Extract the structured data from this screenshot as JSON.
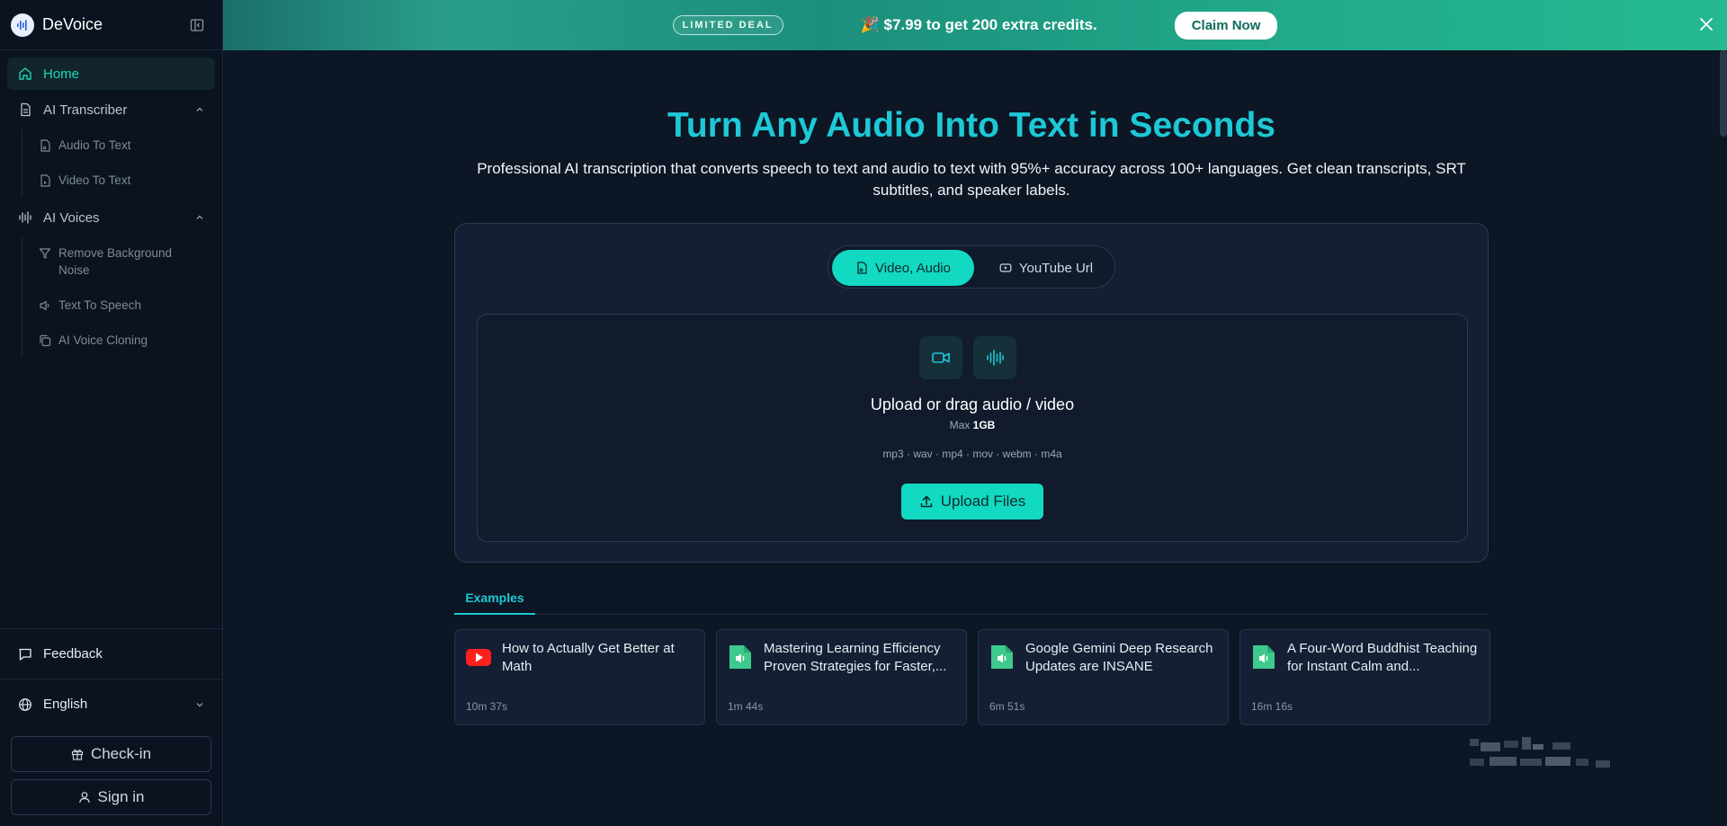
{
  "app": {
    "name": "DeVoice"
  },
  "sidebar": {
    "home": "Home",
    "transcriber": {
      "label": "AI Transcriber",
      "items": [
        "Audio To Text",
        "Video To Text"
      ]
    },
    "voices": {
      "label": "AI Voices",
      "items": [
        "Remove Background Noise",
        "Text To Speech",
        "AI Voice Cloning"
      ]
    },
    "feedback": "Feedback",
    "language": "English",
    "checkin": "Check-in",
    "signin": "Sign in"
  },
  "banner": {
    "badge": "LIMITED DEAL",
    "text": "🎉 $7.99 to get 200 extra credits.",
    "cta": "Claim Now"
  },
  "hero": {
    "title": "Turn Any Audio Into Text in Seconds",
    "subtitle": "Professional AI transcription that converts speech to text and audio to text with 95%+ accuracy across 100+ languages. Get clean transcripts, SRT subtitles, and speaker labels."
  },
  "upload": {
    "tabs": [
      "Video, Audio",
      "YouTube Url"
    ],
    "title": "Upload or drag audio / video",
    "max_prefix": "Max",
    "max_value": "1GB",
    "formats": "mp3 · wav · mp4 · mov · webm · m4a",
    "button": "Upload Files"
  },
  "examples": {
    "tab": "Examples",
    "items": [
      {
        "title": "How to Actually Get Better at Math",
        "duration": "10m 37s",
        "icon": "youtube-icon"
      },
      {
        "title": "Mastering Learning Efficiency Proven Strategies for Faster,...",
        "duration": "1m 44s",
        "icon": "audio-file-icon"
      },
      {
        "title": "Google Gemini Deep Research Updates are INSANE",
        "duration": "6m 51s",
        "icon": "audio-file-icon"
      },
      {
        "title": "A Four-Word Buddhist Teaching for Instant Calm and...",
        "duration": "16m 16s",
        "icon": "audio-file-icon"
      }
    ]
  },
  "colors": {
    "accent": "#12d9c1",
    "title": "#1ec8d6",
    "background": "#0c1624"
  }
}
